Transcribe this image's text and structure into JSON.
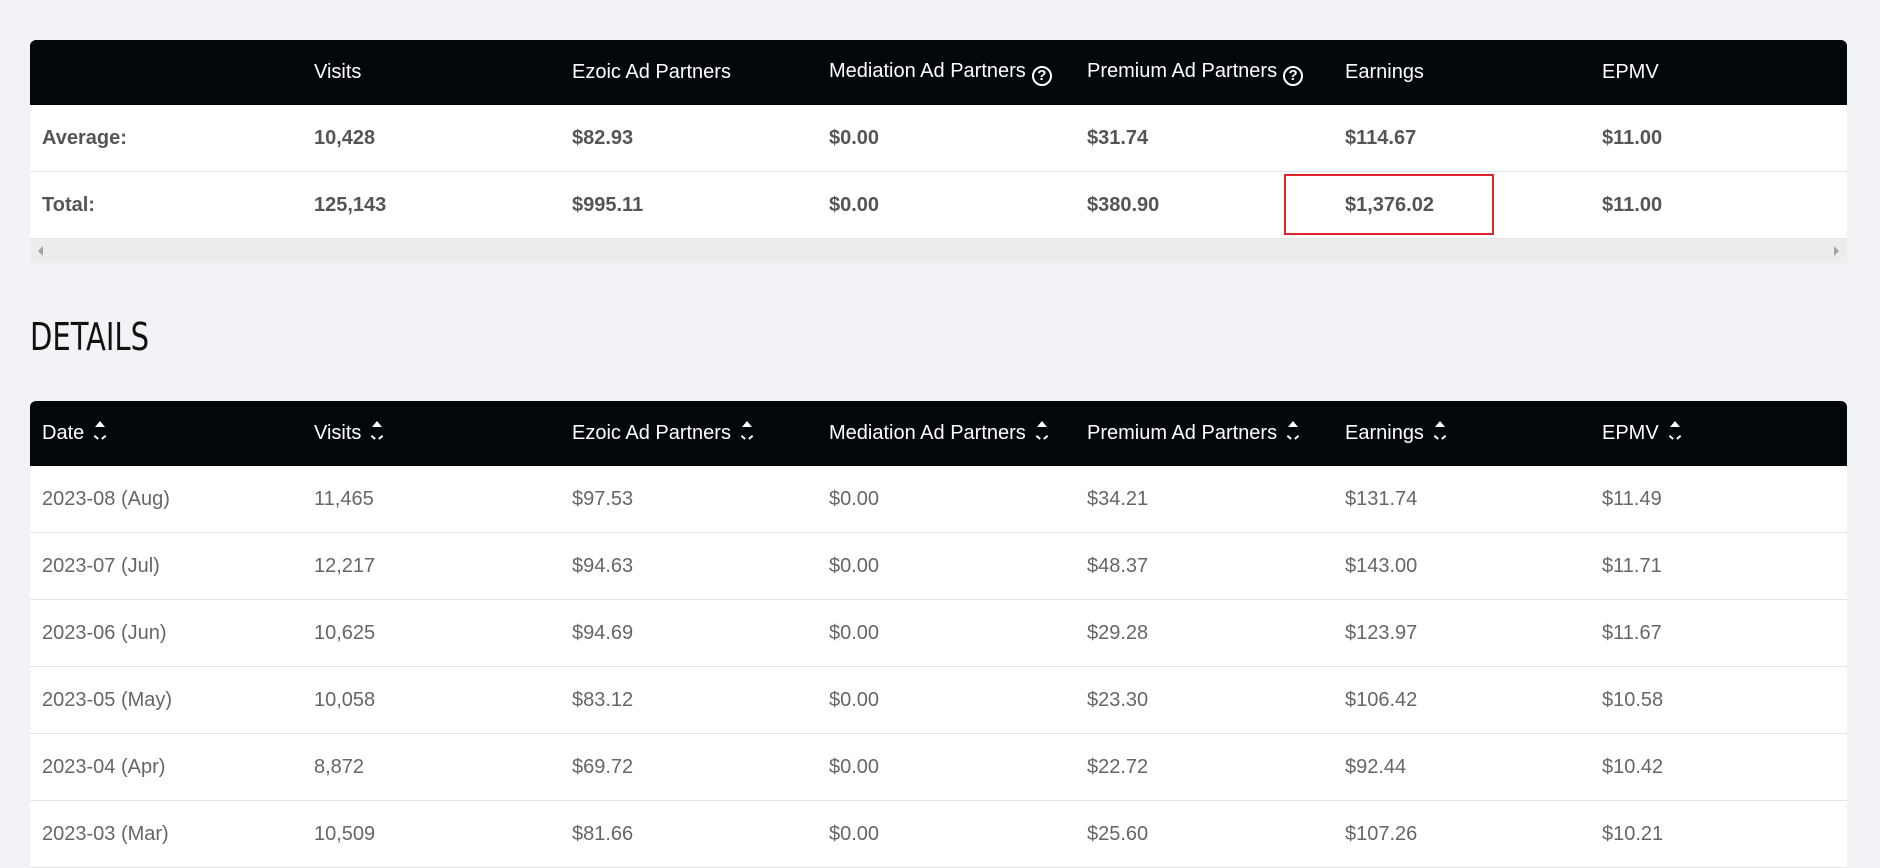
{
  "summary": {
    "headers": [
      "",
      "Visits",
      "Ezoic Ad Partners",
      "Mediation Ad Partners",
      "Premium Ad Partners",
      "Earnings",
      "EPMV"
    ],
    "rows": [
      {
        "label": "Average:",
        "cells": [
          "10,428",
          "$82.93",
          "$0.00",
          "$31.74",
          "$114.67",
          "$11.00"
        ]
      },
      {
        "label": "Total:",
        "cells": [
          "125,143",
          "$995.11",
          "$0.00",
          "$380.90",
          "$1,376.02",
          "$11.00"
        ]
      }
    ],
    "help_icon_glyph": "?"
  },
  "details": {
    "title": "DETAILS",
    "headers": [
      "Date",
      "Visits",
      "Ezoic Ad Partners",
      "Mediation Ad Partners",
      "Premium Ad Partners",
      "Earnings",
      "EPMV"
    ],
    "rows": [
      [
        "2023-08 (Aug)",
        "11,465",
        "$97.53",
        "$0.00",
        "$34.21",
        "$131.74",
        "$11.49"
      ],
      [
        "2023-07 (Jul)",
        "12,217",
        "$94.63",
        "$0.00",
        "$48.37",
        "$143.00",
        "$11.71"
      ],
      [
        "2023-06 (Jun)",
        "10,625",
        "$94.69",
        "$0.00",
        "$29.28",
        "$123.97",
        "$11.67"
      ],
      [
        "2023-05 (May)",
        "10,058",
        "$83.12",
        "$0.00",
        "$23.30",
        "$106.42",
        "$10.58"
      ],
      [
        "2023-04 (Apr)",
        "8,872",
        "$69.72",
        "$0.00",
        "$22.72",
        "$92.44",
        "$10.42"
      ],
      [
        "2023-03 (Mar)",
        "10,509",
        "$81.66",
        "$0.00",
        "$25.60",
        "$107.26",
        "$10.21"
      ]
    ]
  },
  "colors": {
    "header_bg": "#03070b",
    "page_bg": "#f2f3f7",
    "highlight": "#e0242c"
  }
}
